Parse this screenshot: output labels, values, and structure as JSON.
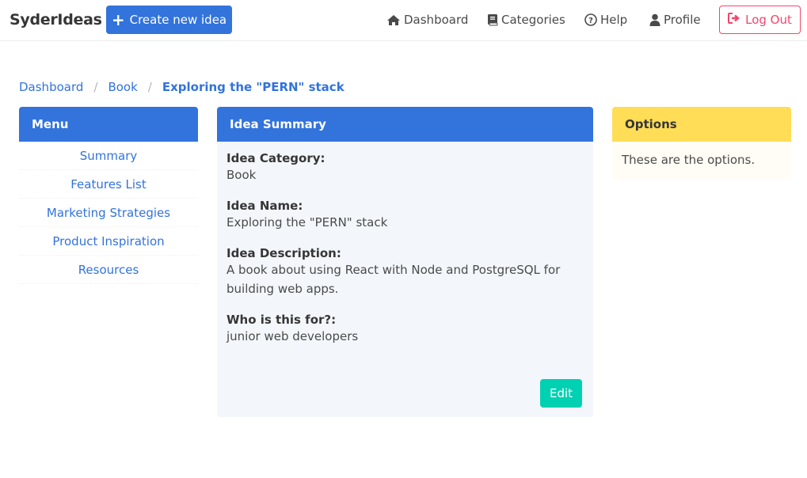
{
  "navbar": {
    "brand": "SyderIdeas",
    "create_button": "Create new idea",
    "items": [
      {
        "label": "Dashboard",
        "icon": "home-icon"
      },
      {
        "label": "Categories",
        "icon": "book-icon"
      },
      {
        "label": "Help",
        "icon": "question-circle-icon"
      },
      {
        "label": "Profile",
        "icon": "user-icon"
      }
    ],
    "logout_button": "Log Out"
  },
  "breadcrumb": {
    "items": [
      "Dashboard",
      "Book"
    ],
    "active": "Exploring the \"PERN\" stack"
  },
  "menu": {
    "heading": "Menu",
    "items": [
      "Summary",
      "Features List",
      "Marketing Strategies",
      "Product Inspiration",
      "Resources"
    ]
  },
  "summary": {
    "heading": "Idea Summary",
    "fields": [
      {
        "label": "Idea Category:",
        "value": "Book"
      },
      {
        "label": "Idea Name:",
        "value": "Exploring the \"PERN\" stack"
      },
      {
        "label": "Idea Description:",
        "value": "A book about using React with Node and PostgreSQL for building web apps."
      },
      {
        "label": "Who is this for?:",
        "value": "junior web developers"
      }
    ],
    "edit_button": "Edit"
  },
  "options": {
    "heading": "Options",
    "text": "These are the options."
  },
  "colors": {
    "primary": "#3273dc",
    "success": "#00d1b2",
    "warning": "#ffdd57",
    "danger": "#f14668"
  }
}
